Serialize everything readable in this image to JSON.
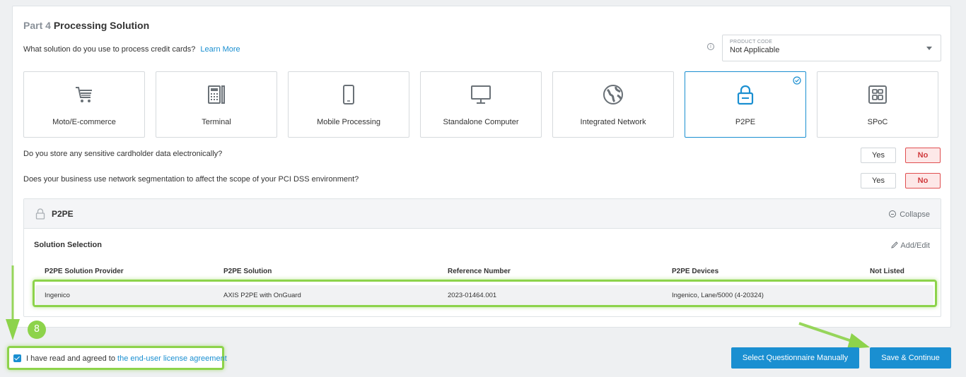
{
  "header": {
    "part_num": "Part 4",
    "title": "Processing Solution",
    "question": "What solution do you use to process credit cards?",
    "learn_more": "Learn More"
  },
  "product_code": {
    "label": "PRODUCT CODE",
    "value": "Not Applicable",
    "info_icon": "info-icon"
  },
  "tiles": [
    {
      "label": "Moto/E-commerce",
      "icon": "cart-icon"
    },
    {
      "label": "Terminal",
      "icon": "terminal-icon"
    },
    {
      "label": "Mobile Processing",
      "icon": "mobile-icon"
    },
    {
      "label": "Standalone Computer",
      "icon": "monitor-icon"
    },
    {
      "label": "Integrated Network",
      "icon": "globe-icon"
    },
    {
      "label": "P2PE",
      "icon": "lock-icon",
      "selected": true
    },
    {
      "label": "SPoC",
      "icon": "spoc-icon"
    }
  ],
  "questions": [
    {
      "text": "Do you store any sensitive cardholder data electronically?",
      "yes": "Yes",
      "no": "No",
      "selected": "No"
    },
    {
      "text": "Does your business use network segmentation to affect the scope of your PCI DSS environment?",
      "yes": "Yes",
      "no": "No",
      "selected": "No"
    }
  ],
  "p2pe_section": {
    "title": "P2PE",
    "collapse": "Collapse",
    "solution_selection": "Solution Selection",
    "add_edit": "Add/Edit",
    "columns": [
      "P2PE Solution Provider",
      "P2PE Solution",
      "Reference Number",
      "P2PE Devices",
      "Not Listed"
    ],
    "rows": [
      [
        "Ingenico",
        "AXIS P2PE with OnGuard",
        "2023-01464.001",
        "Ingenico, Lane/5000 (4-20324)",
        ""
      ]
    ]
  },
  "step_badge": "8",
  "agreement": {
    "checked": true,
    "text": "I have read and agreed to",
    "link": "the end-user license agreement"
  },
  "buttons": {
    "manual": "Select Questionnaire Manually",
    "save": "Save & Continue"
  },
  "colors": {
    "accent": "#1a8fd1",
    "highlight": "#8dd34b",
    "no_active": "#e04e50"
  }
}
